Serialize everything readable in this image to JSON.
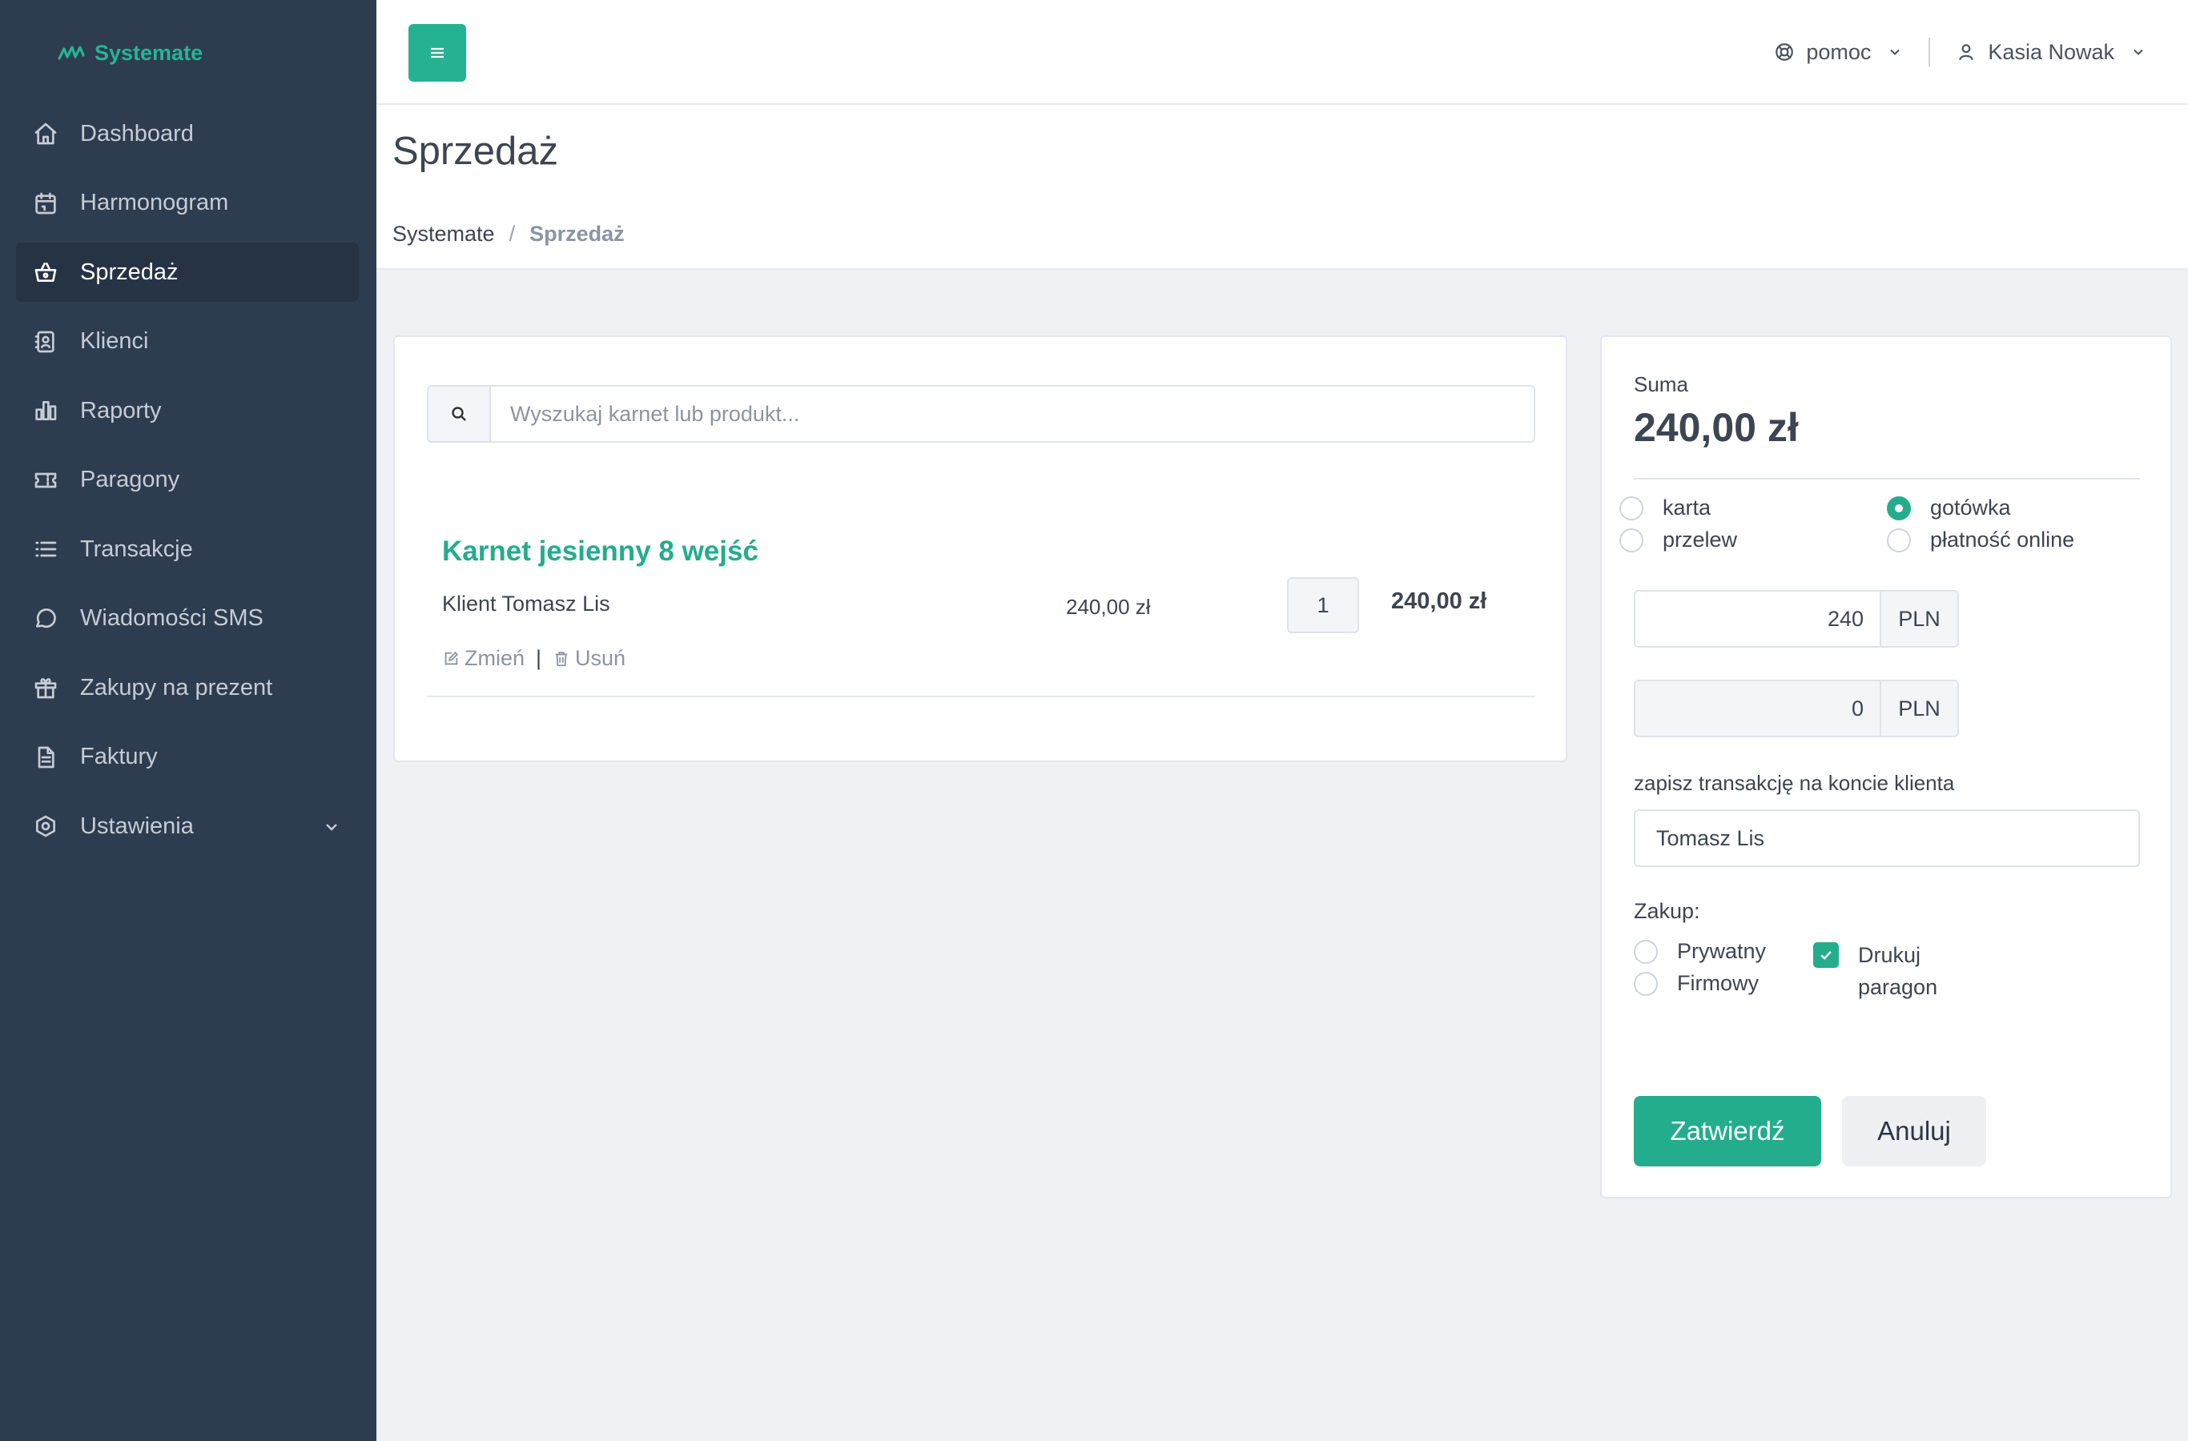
{
  "brand": {
    "name": "Systemate",
    "icon": "logo-wave-icon"
  },
  "sidebar": {
    "items": [
      {
        "label": "Dashboard",
        "icon": "home-icon"
      },
      {
        "label": "Harmonogram",
        "icon": "calendar-icon"
      },
      {
        "label": "Sprzedaż",
        "icon": "basket-icon",
        "active": true
      },
      {
        "label": "Klienci",
        "icon": "contacts-icon"
      },
      {
        "label": "Raporty",
        "icon": "bar-chart-icon"
      },
      {
        "label": "Paragony",
        "icon": "ticket-icon"
      },
      {
        "label": "Transakcje",
        "icon": "list-icon"
      },
      {
        "label": "Wiadomości SMS",
        "icon": "chat-icon"
      },
      {
        "label": "Zakupy na prezent",
        "icon": "gift-icon"
      },
      {
        "label": "Faktury",
        "icon": "document-icon"
      },
      {
        "label": "Ustawienia",
        "icon": "settings-icon",
        "expandable": true
      }
    ]
  },
  "topbar": {
    "menu_icon": "hamburger-icon",
    "help_label": "pomoc",
    "user_name": "Kasia Nowak"
  },
  "page": {
    "title": "Sprzedaż",
    "breadcrumb_home": "Systemate",
    "breadcrumb_sep": "/",
    "breadcrumb_current": "Sprzedaż"
  },
  "search": {
    "placeholder": "Wyszukaj karnet lub produkt..."
  },
  "cart": {
    "items": [
      {
        "name": "Karnet jesienny 8 wejść",
        "client": "Klient Tomasz Lis",
        "unit_price": "240,00 zł",
        "quantity": "1",
        "total": "240,00 zł",
        "edit_label": "Zmień",
        "delete_label": "Usuń",
        "sep": "|"
      }
    ]
  },
  "summary": {
    "label": "Suma",
    "amount": "240,00 zł",
    "payment_methods": [
      {
        "label": "karta",
        "selected": false
      },
      {
        "label": "gotówka",
        "selected": true
      },
      {
        "label": "przelew",
        "selected": false
      },
      {
        "label": "płatność online",
        "selected": false
      }
    ],
    "paid_amount": "240",
    "change_amount": "0",
    "currency": "PLN",
    "account_label": "zapisz transakcję na koncie klienta",
    "account_client": "Tomasz Lis",
    "purchase_label": "Zakup:",
    "purchase_types": [
      {
        "label": "Prywatny",
        "selected": false
      },
      {
        "label": "Firmowy",
        "selected": false
      }
    ],
    "print_receipt_label": "Drukuj paragon",
    "print_receipt_checked": true,
    "confirm_label": "Zatwierdź",
    "cancel_label": "Anuluj"
  },
  "colors": {
    "accent": "#23ad8d",
    "sidebar": "#2e3c50",
    "background": "#eff1f5"
  }
}
